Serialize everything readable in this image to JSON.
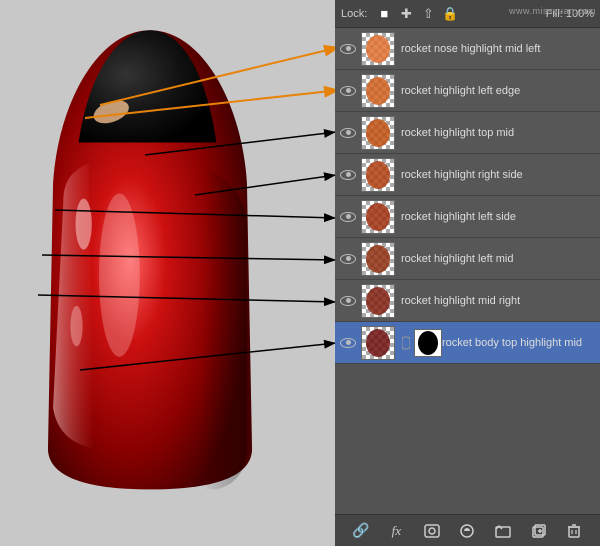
{
  "toolbar": {
    "lock_label": "Lock:",
    "opacity_label": "Fill: 100%",
    "watermark": "www.missyuan.com"
  },
  "layers": [
    {
      "id": 1,
      "name": "rocket nose highlight mid left",
      "visible": true,
      "selected": false,
      "has_mask": false,
      "thumb_color": "#e07030"
    },
    {
      "id": 2,
      "name": "rocket highlight left edge",
      "visible": true,
      "selected": false,
      "has_mask": false,
      "thumb_color": "#d06020"
    },
    {
      "id": 3,
      "name": "rocket highlight top mid",
      "visible": true,
      "selected": false,
      "has_mask": false,
      "thumb_color": "#c05010"
    },
    {
      "id": 4,
      "name": "rocket highlight right side",
      "visible": true,
      "selected": false,
      "has_mask": false,
      "thumb_color": "#b04010"
    },
    {
      "id": 5,
      "name": "rocket highlight left side",
      "visible": true,
      "selected": false,
      "has_mask": false,
      "thumb_color": "#a03010"
    },
    {
      "id": 6,
      "name": "rocket highlight left mid",
      "visible": true,
      "selected": false,
      "has_mask": false,
      "thumb_color": "#903010"
    },
    {
      "id": 7,
      "name": "rocket highlight mid right",
      "visible": true,
      "selected": false,
      "has_mask": false,
      "thumb_color": "#802010"
    },
    {
      "id": 8,
      "name": "rocket body top highlight mid",
      "visible": true,
      "selected": true,
      "has_mask": true,
      "thumb_color": "#701010"
    }
  ],
  "bottom_icons": [
    "link",
    "fx",
    "mask",
    "adjustments",
    "folder",
    "new-layer",
    "trash"
  ]
}
